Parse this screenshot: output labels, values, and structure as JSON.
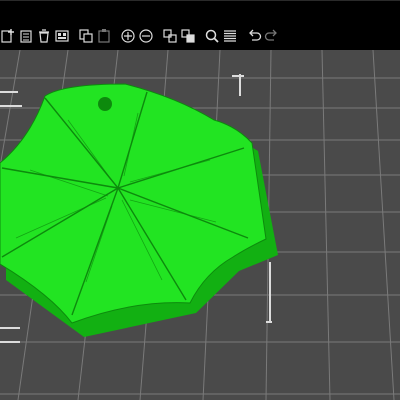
{
  "app": {
    "toolbar": {
      "tools": [
        {
          "name": "add-icon"
        },
        {
          "name": "delete-icon"
        },
        {
          "name": "delete-all-icon"
        },
        {
          "name": "arrange-icon"
        },
        {
          "name": "copy-icon"
        },
        {
          "name": "paste-icon"
        },
        {
          "name": "add-instance-icon"
        },
        {
          "name": "remove-instance-icon"
        },
        {
          "name": "split-to-objects-icon"
        },
        {
          "name": "split-to-parts-icon"
        },
        {
          "name": "search-icon"
        },
        {
          "name": "layers-editing-icon"
        },
        {
          "name": "undo-icon"
        },
        {
          "name": "redo-icon"
        }
      ]
    },
    "viewport": {
      "bed_color": "#4a4a4a",
      "grid_color": "#7a7a7a",
      "model_color": "#22e422",
      "model_edge_color": "#0d8a0d",
      "model_side_color": "#12b012"
    }
  }
}
